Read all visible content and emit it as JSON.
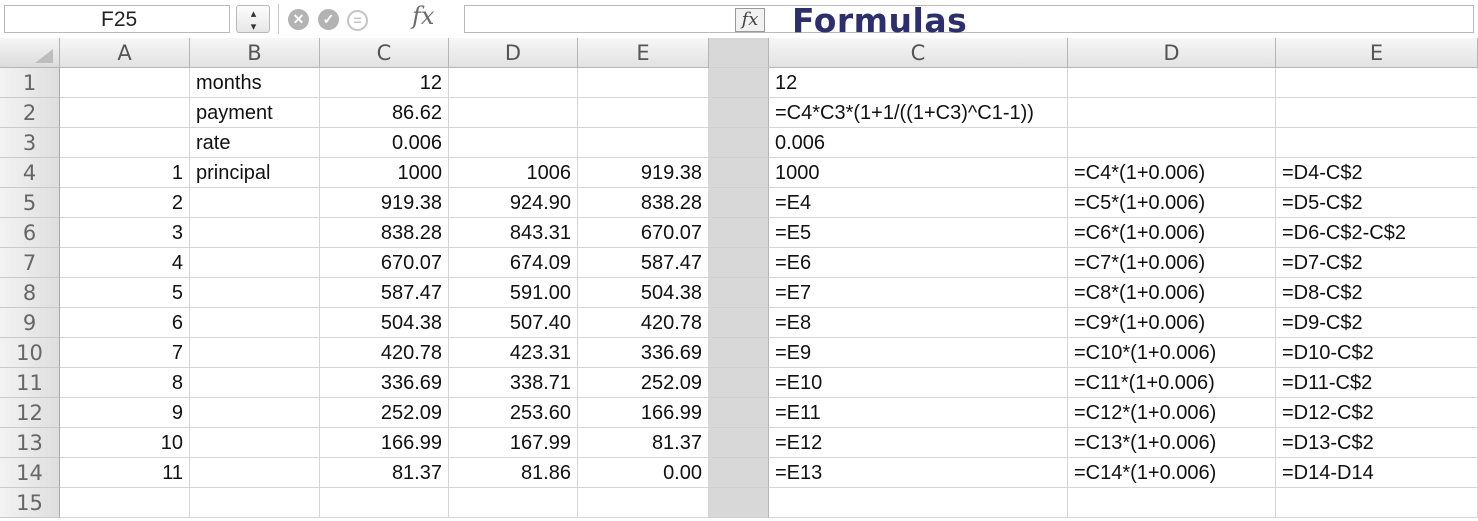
{
  "formula_bar": {
    "name_box": "F25",
    "stepper_glyph": "▴▾",
    "cancel_icon": "✕",
    "confirm_icon": "✓",
    "circle_icon": "=",
    "fx_label": "fx",
    "right_fx_label": "fx",
    "formula_value": ""
  },
  "section_title": "Formulas",
  "left_columns": [
    "A",
    "B",
    "C",
    "D",
    "E"
  ],
  "right_columns": [
    "C",
    "D",
    "E"
  ],
  "row_numbers": [
    "1",
    "2",
    "3",
    "4",
    "5",
    "6",
    "7",
    "8",
    "9",
    "10",
    "11",
    "12",
    "13",
    "14",
    "15"
  ],
  "values_rows": [
    {
      "A": "",
      "B": "months",
      "C": "12",
      "D": "",
      "E": ""
    },
    {
      "A": "",
      "B": "payment",
      "C": "86.62",
      "D": "",
      "E": ""
    },
    {
      "A": "",
      "B": "rate",
      "C": "0.006",
      "D": "",
      "E": ""
    },
    {
      "A": "1",
      "B": "principal",
      "C": "1000",
      "D": "1006",
      "E": "919.38"
    },
    {
      "A": "2",
      "B": "",
      "C": "919.38",
      "D": "924.90",
      "E": "838.28"
    },
    {
      "A": "3",
      "B": "",
      "C": "838.28",
      "D": "843.31",
      "E": "670.07"
    },
    {
      "A": "4",
      "B": "",
      "C": "670.07",
      "D": "674.09",
      "E": "587.47"
    },
    {
      "A": "5",
      "B": "",
      "C": "587.47",
      "D": "591.00",
      "E": "504.38"
    },
    {
      "A": "6",
      "B": "",
      "C": "504.38",
      "D": "507.40",
      "E": "420.78"
    },
    {
      "A": "7",
      "B": "",
      "C": "420.78",
      "D": "423.31",
      "E": "336.69"
    },
    {
      "A": "8",
      "B": "",
      "C": "336.69",
      "D": "338.71",
      "E": "252.09"
    },
    {
      "A": "9",
      "B": "",
      "C": "252.09",
      "D": "253.60",
      "E": "166.99"
    },
    {
      "A": "10",
      "B": "",
      "C": "166.99",
      "D": "167.99",
      "E": "81.37"
    },
    {
      "A": "11",
      "B": "",
      "C": "81.37",
      "D": "81.86",
      "E": "0.00"
    },
    {
      "A": "",
      "B": "",
      "C": "",
      "D": "",
      "E": ""
    }
  ],
  "formula_rows": [
    {
      "C": "12",
      "D": "",
      "E": ""
    },
    {
      "C": "=C4*C3*(1+1/((1+C3)^C1-1))",
      "D": "",
      "E": ""
    },
    {
      "C": "0.006",
      "D": "",
      "E": ""
    },
    {
      "C": "1000",
      "D": "=C4*(1+0.006)",
      "E": "=D4-C$2"
    },
    {
      "C": "=E4",
      "D": "=C5*(1+0.006)",
      "E": "=D5-C$2"
    },
    {
      "C": "=E5",
      "D": "=C6*(1+0.006)",
      "E": "=D6-C$2-C$2"
    },
    {
      "C": "=E6",
      "D": "=C7*(1+0.006)",
      "E": "=D7-C$2"
    },
    {
      "C": "=E7",
      "D": "=C8*(1+0.006)",
      "E": "=D8-C$2"
    },
    {
      "C": "=E8",
      "D": "=C9*(1+0.006)",
      "E": "=D9-C$2"
    },
    {
      "C": "=E9",
      "D": "=C10*(1+0.006)",
      "E": "=D10-C$2"
    },
    {
      "C": "=E10",
      "D": "=C11*(1+0.006)",
      "E": "=D11-C$2"
    },
    {
      "C": "=E11",
      "D": "=C12*(1+0.006)",
      "E": "=D12-C$2"
    },
    {
      "C": "=E12",
      "D": "=C13*(1+0.006)",
      "E": "=D13-C$2"
    },
    {
      "C": "=E13",
      "D": "=C14*(1+0.006)",
      "E": "=D14-D14"
    },
    {
      "C": "",
      "D": "",
      "E": ""
    }
  ]
}
